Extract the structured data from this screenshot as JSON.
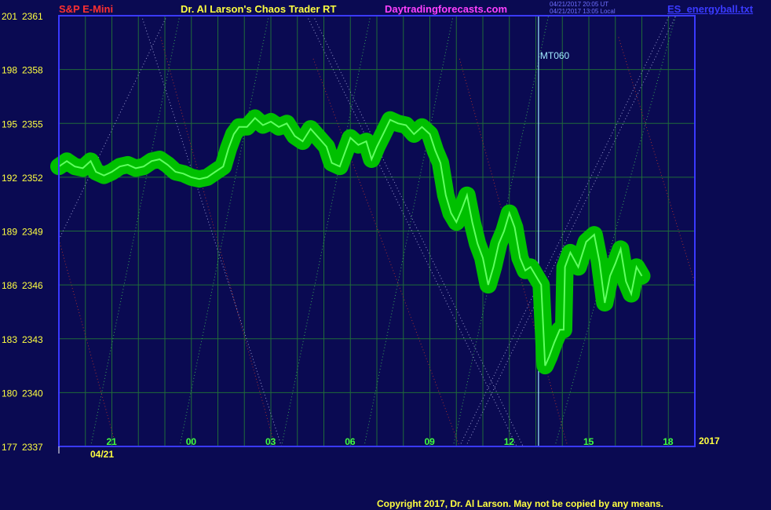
{
  "header": {
    "left_title": "S&P E-Mini",
    "center_title": "Dr. Al Larson's Chaos Trader RT",
    "website": "Daytradingforecasts.com",
    "file_name": "ES_energyball.txt",
    "utc_stamp": "04/21/2017 20:05 UT",
    "local_stamp": "04/21/2017 13:05 Local"
  },
  "footer": {
    "copyright": "Copyright 2017, Dr. Al Larson. May not be copied by any means."
  },
  "colors": {
    "background": "#0a0a52",
    "plot_border": "#3a3aff",
    "grid": "#1f6b3a",
    "price_fill": "#00c000",
    "price_line": "#60ff60",
    "flux_green": "#3aa55a",
    "flux_red": "#a83030",
    "flux_white": "#9a9ad0",
    "marker_line": "#a0e8ff",
    "axis_text": "#ffff40",
    "time_text": "#40ff40"
  },
  "chart_data": {
    "type": "line",
    "y_ticks": [
      {
        "left": "201",
        "right": "2361",
        "price": 2361
      },
      {
        "left": "198",
        "right": "2358",
        "price": 2358
      },
      {
        "left": "195",
        "right": "2355",
        "price": 2355
      },
      {
        "left": "192",
        "right": "2352",
        "price": 2352
      },
      {
        "left": "189",
        "right": "2349",
        "price": 2349
      },
      {
        "left": "186",
        "right": "2346",
        "price": 2346
      },
      {
        "left": "183",
        "right": "2343",
        "price": 2343
      },
      {
        "left": "180",
        "right": "2340",
        "price": 2340
      },
      {
        "left": "177",
        "right": "2337",
        "price": 2337
      }
    ],
    "ylim": [
      2337,
      2361
    ],
    "xlim": [
      19.0,
      43.0
    ],
    "x_unit": "hours from 04/20 00:00",
    "x_ticks": [
      {
        "label": "21",
        "t": 21
      },
      {
        "label": "00",
        "t": 24
      },
      {
        "label": "03",
        "t": 27
      },
      {
        "label": "06",
        "t": 30
      },
      {
        "label": "09",
        "t": 33
      },
      {
        "label": "12",
        "t": 36
      },
      {
        "label": "15",
        "t": 39
      },
      {
        "label": "18",
        "t": 42
      }
    ],
    "date_label": "04/21",
    "year_label": "2017",
    "grid": true,
    "marker": {
      "label": "MT060",
      "t": 37.1
    },
    "series": [
      {
        "points": [
          [
            19.0,
            2352.6
          ],
          [
            19.3,
            2352.9
          ],
          [
            19.6,
            2352.6
          ],
          [
            19.9,
            2352.5
          ],
          [
            20.2,
            2352.9
          ],
          [
            20.4,
            2352.3
          ],
          [
            20.7,
            2352.1
          ],
          [
            21.0,
            2352.3
          ],
          [
            21.3,
            2352.6
          ],
          [
            21.6,
            2352.7
          ],
          [
            21.9,
            2352.5
          ],
          [
            22.2,
            2352.6
          ],
          [
            22.5,
            2352.9
          ],
          [
            22.8,
            2353.0
          ],
          [
            23.1,
            2352.7
          ],
          [
            23.4,
            2352.3
          ],
          [
            23.7,
            2352.2
          ],
          [
            24.0,
            2352.0
          ],
          [
            24.3,
            2351.9
          ],
          [
            24.6,
            2352.0
          ],
          [
            24.9,
            2352.3
          ],
          [
            25.2,
            2352.6
          ],
          [
            25.4,
            2353.6
          ],
          [
            25.6,
            2354.4
          ],
          [
            25.8,
            2354.8
          ],
          [
            26.1,
            2354.8
          ],
          [
            26.4,
            2355.3
          ],
          [
            26.7,
            2354.9
          ],
          [
            27.0,
            2355.1
          ],
          [
            27.3,
            2354.8
          ],
          [
            27.6,
            2355.0
          ],
          [
            27.9,
            2354.3
          ],
          [
            28.2,
            2354.0
          ],
          [
            28.5,
            2354.7
          ],
          [
            28.8,
            2354.2
          ],
          [
            29.1,
            2353.7
          ],
          [
            29.3,
            2352.8
          ],
          [
            29.6,
            2352.6
          ],
          [
            29.8,
            2353.4
          ],
          [
            30.0,
            2354.2
          ],
          [
            30.3,
            2353.8
          ],
          [
            30.6,
            2354.0
          ],
          [
            30.8,
            2353.0
          ],
          [
            31.0,
            2353.7
          ],
          [
            31.2,
            2354.3
          ],
          [
            31.5,
            2355.2
          ],
          [
            31.8,
            2355.0
          ],
          [
            32.1,
            2354.9
          ],
          [
            32.4,
            2354.4
          ],
          [
            32.7,
            2354.8
          ],
          [
            33.0,
            2354.4
          ],
          [
            33.2,
            2353.5
          ],
          [
            33.4,
            2352.8
          ],
          [
            33.6,
            2351.0
          ],
          [
            33.8,
            2350.0
          ],
          [
            34.0,
            2349.5
          ],
          [
            34.2,
            2350.2
          ],
          [
            34.4,
            2351.0
          ],
          [
            34.6,
            2349.5
          ],
          [
            34.8,
            2348.3
          ],
          [
            35.0,
            2347.5
          ],
          [
            35.2,
            2346.0
          ],
          [
            35.4,
            2347.0
          ],
          [
            35.6,
            2348.3
          ],
          [
            35.8,
            2349.0
          ],
          [
            36.0,
            2350.0
          ],
          [
            36.2,
            2349.2
          ],
          [
            36.4,
            2347.5
          ],
          [
            36.6,
            2346.8
          ],
          [
            36.8,
            2347.0
          ],
          [
            37.0,
            2346.5
          ],
          [
            37.2,
            2346.0
          ],
          [
            37.35,
            2341.5
          ],
          [
            37.5,
            2342.0
          ],
          [
            37.7,
            2342.8
          ],
          [
            37.9,
            2343.5
          ],
          [
            38.05,
            2343.5
          ],
          [
            38.1,
            2347.0
          ],
          [
            38.3,
            2347.8
          ],
          [
            38.6,
            2347.0
          ],
          [
            38.9,
            2348.4
          ],
          [
            39.2,
            2348.8
          ],
          [
            39.4,
            2347.3
          ],
          [
            39.6,
            2345.0
          ],
          [
            39.8,
            2346.5
          ],
          [
            40.0,
            2347.2
          ],
          [
            40.2,
            2348.0
          ],
          [
            40.4,
            2346.2
          ],
          [
            40.6,
            2345.5
          ],
          [
            40.8,
            2347.0
          ],
          [
            41.0,
            2346.5
          ]
        ]
      }
    ]
  }
}
